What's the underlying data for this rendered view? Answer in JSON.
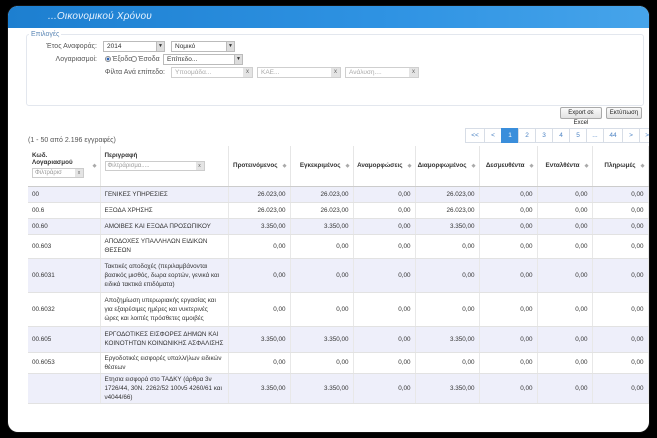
{
  "window": {
    "title": "...Οικονομικού Χρόνου"
  },
  "filters": {
    "legend": "Επιλογές",
    "year_label": "Έτος Αναφοράς:",
    "year_value": "2014",
    "type_value": "Νομικό",
    "accounts_label": "Λογαριασμοί:",
    "radio_expenses": "Έξοδα",
    "radio_income": "Έσοδα",
    "level_value": "Επίπεδο...",
    "level_filter_label": "Φίλτα Ανά επίπεδο:",
    "f1_placeholder": "Υποομάδα...",
    "f2_placeholder": "ΚΑΕ...",
    "f3_placeholder": "Ανάλυση...."
  },
  "toolbar": {
    "export_label": "Export σε Excel",
    "print_label": "Εκτύπωση"
  },
  "results": {
    "count_text": "(1 - 50 από 2.196 εγγραφές)"
  },
  "pager": {
    "first": "<<",
    "prev": "<",
    "pages": [
      "1",
      "2",
      "3",
      "4",
      "5",
      "...",
      "44"
    ],
    "next": ">",
    "last": ">>"
  },
  "table": {
    "headers": {
      "code": "Κωδ. Λογαριασμού",
      "code_filter": "Φιλτράρισ",
      "desc": "Περιγραφή",
      "desc_filter": "Φιλτράρισμα.....",
      "proposed": "Προτεινόμενος",
      "approved": "Εγκεκριμένος",
      "reserved": "Αναμορφώσεις",
      "formed": "Διαμορφωμένος",
      "committed": "Δεσμευθέντα",
      "ordered": "Ενταλθέντα",
      "paid": "Πληρωμές"
    },
    "rows": [
      {
        "code": "00",
        "desc": "ΓΕΝΙΚΕΣ ΥΠΗΡΕΣΙΕΣ",
        "v": [
          "26.023,00",
          "26.023,00",
          "0,00",
          "26.023,00",
          "0,00",
          "0,00",
          "0,00"
        ]
      },
      {
        "code": "00.6",
        "desc": "ΕΞΟΔΑ ΧΡΗΣΗΣ",
        "v": [
          "26.023,00",
          "26.023,00",
          "0,00",
          "26.023,00",
          "0,00",
          "0,00",
          "0,00"
        ]
      },
      {
        "code": "00.60",
        "desc": "ΑΜΟΙΒΕΣ ΚΑΙ ΕΞΟΔΑ ΠΡΟΣΩΠΙΚΟΥ",
        "v": [
          "3.350,00",
          "3.350,00",
          "0,00",
          "3.350,00",
          "0,00",
          "0,00",
          "0,00"
        ]
      },
      {
        "code": "00.603",
        "desc": "ΑΠΟΔΟΧΕΣ ΥΠΑΛΛΗΛΩΝ ΕΙΔΙΚΩΝ ΘΕΣΕΩΝ",
        "v": [
          "0,00",
          "0,00",
          "0,00",
          "0,00",
          "0,00",
          "0,00",
          "0,00"
        ]
      },
      {
        "code": "00.6031",
        "desc": "Τακτικές αποδοχές (περιλαμβάνονται βασικός μισθός, δωρα εορτών, γενικά και ειδικά τακτικά επιδόματα)",
        "v": [
          "0,00",
          "0,00",
          "0,00",
          "0,00",
          "0,00",
          "0,00",
          "0,00"
        ]
      },
      {
        "code": "00.6032",
        "desc": "Αποζημίωση υπερωριακής εργασίας και για εξαιρέσιμες ημέρες και νυκτερινές ώρες και λοιπές πρόσθετες αμοιβές",
        "v": [
          "0,00",
          "0,00",
          "0,00",
          "0,00",
          "0,00",
          "0,00",
          "0,00"
        ]
      },
      {
        "code": "00.605",
        "desc": "ΕΡΓΟΔΟΤΙΚΕΣ ΕΙΣΦΟΡΕΣ ΔΗΜΩΝ ΚΑΙ ΚΟΙΝΟΤΗΤΩΝ ΚΟΙΝΩΝΙΚΗΣ ΑΣΦΑΛΙΣΗΣ",
        "v": [
          "3.350,00",
          "3.350,00",
          "0,00",
          "3.350,00",
          "0,00",
          "0,00",
          "0,00"
        ]
      },
      {
        "code": "00.6053",
        "desc": "Εργοδοτικές εισφορές υπαλλήλων ειδικών θέσεων",
        "v": [
          "0,00",
          "0,00",
          "0,00",
          "0,00",
          "0,00",
          "0,00",
          "0,00"
        ]
      },
      {
        "code": "",
        "desc": "Ετησια εισφορά στο ΤΑΔΚΥ (άρθρα 3ν 1726/44, 30Ν. 2262/52 100ν5 4260/61 και ν4044/66)",
        "v": [
          "3.350,00",
          "3.350,00",
          "0,00",
          "3.350,00",
          "0,00",
          "0,00",
          "0,00"
        ]
      }
    ]
  }
}
